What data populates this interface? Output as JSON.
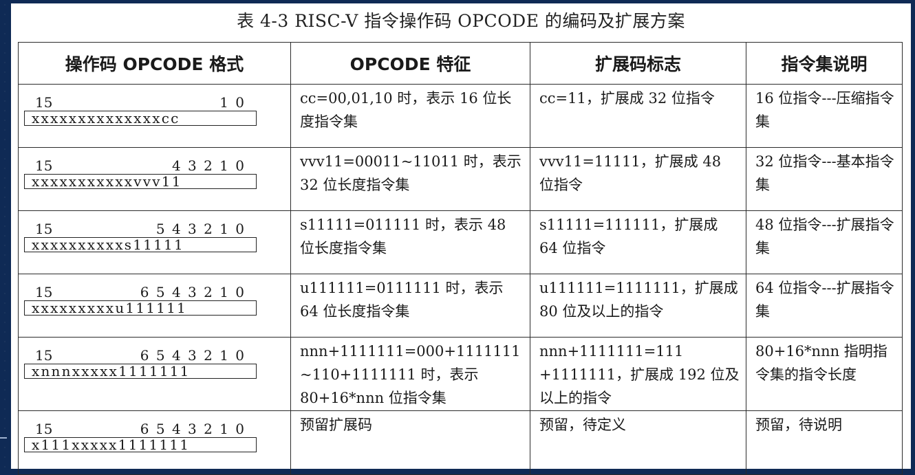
{
  "caption": "表 4-3 RISC-V 指令操作码 OPCODE 的编码及扩展方案",
  "headers": [
    "操作码 OPCODE 格式",
    "OPCODE 特征",
    "扩展码标志",
    "指令集说明"
  ],
  "rows": [
    {
      "bit_hi": "15",
      "bit_lo": "1 0",
      "code": "xxxxxxxxxxxxxxcc",
      "feature": "cc=00,01,10 时，表示 16 位长度指令集",
      "flag": "cc=11，扩展成 32 位指令",
      "desc": "16 位指令---压缩指令集"
    },
    {
      "bit_hi": "15",
      "bit_lo": "4 3 2 1 0",
      "code": "xxxxxxxxxxxvvv11",
      "feature": "vvv11=00011~11011 时，表示 32 位长度指令集",
      "flag": "vvv11=11111，扩展成 48 位指令",
      "desc": "32 位指令---基本指令集"
    },
    {
      "bit_hi": "15",
      "bit_lo": "5 4 3 2 1 0",
      "code": "xxxxxxxxxxs11111",
      "feature": "s11111=011111 时，表示 48 位长度指令集",
      "flag": "s11111=111111，扩展成 64 位指令",
      "desc": "48 位指令---扩展指令集"
    },
    {
      "bit_hi": "15",
      "bit_lo": "6 5 4 3 2 1 0",
      "code": "xxxxxxxxxu111111",
      "feature": "u111111=0111111 时，表示 64 位长度指令集",
      "flag": "u111111=1111111，扩展成 80 位及以上的指令",
      "desc": "64 位指令---扩展指令集"
    },
    {
      "bit_hi": "15",
      "bit_lo": "6 5 4 3 2 1 0",
      "code": "xnnnxxxxx1111111",
      "feature": "nnn+1111111=000+1111111 ~110+1111111 时，表示 80+16*nnn 位指令集",
      "flag": "nnn+1111111=111 +1111111，扩展成 192 位及以上的指令",
      "desc": "80+16*nnn 指明指令集的指令长度"
    },
    {
      "bit_hi": "15",
      "bit_lo": "6 5 4 3 2 1 0",
      "code": "x111xxxxx1111111",
      "feature": "预留扩展码",
      "flag": "预留，待定义",
      "desc": "预留，待说明"
    }
  ]
}
